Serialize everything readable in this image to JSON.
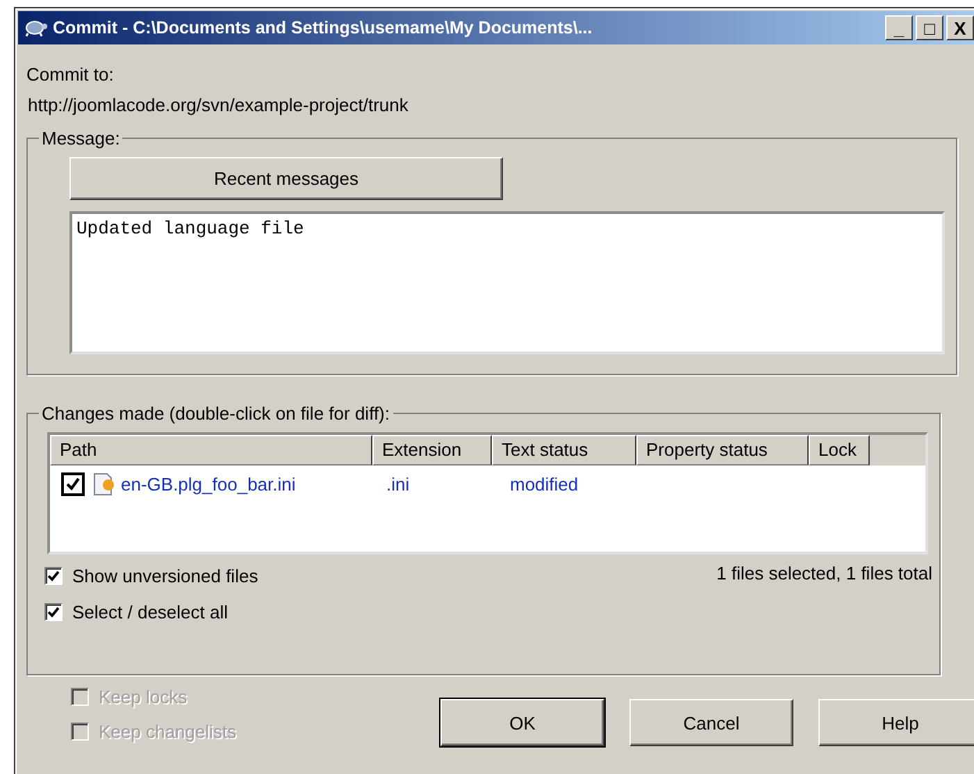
{
  "window": {
    "title": "Commit - C:\\Documents and Settings\\usemame\\My Documents\\...",
    "controls": [
      "_",
      "□",
      "X"
    ]
  },
  "commit_to": {
    "label": "Commit to:",
    "url": "http://joomlacode.org/svn/example-project/trunk"
  },
  "message": {
    "group_label": "Message:",
    "recent_button": "Recent messages",
    "value": "Updated language file"
  },
  "changes": {
    "group_label": "Changes made (double-click on file for diff):",
    "table": {
      "columns": [
        "Path",
        "Extension",
        "Text status",
        "Property status",
        "Lock"
      ],
      "rows": [
        {
          "checked": true,
          "path": "en-GB.plg_foo_bar.ini",
          "extension": ".ini",
          "text_status": "modified"
        }
      ]
    },
    "options": [
      {
        "label": "Show unversioned files",
        "checked": true
      },
      {
        "label": "Select / deselect all",
        "checked": true
      }
    ],
    "summary": "1 files selected, 1 files total"
  },
  "keep_options": [
    {
      "label": "Keep locks",
      "checked": false,
      "disabled": true
    },
    {
      "label": "Keep changelists",
      "checked": false,
      "disabled": true
    }
  ],
  "buttons": [
    {
      "label": "OK",
      "default": true
    },
    {
      "label": "Cancel",
      "default": false
    },
    {
      "label": "Help",
      "default": false
    }
  ]
}
